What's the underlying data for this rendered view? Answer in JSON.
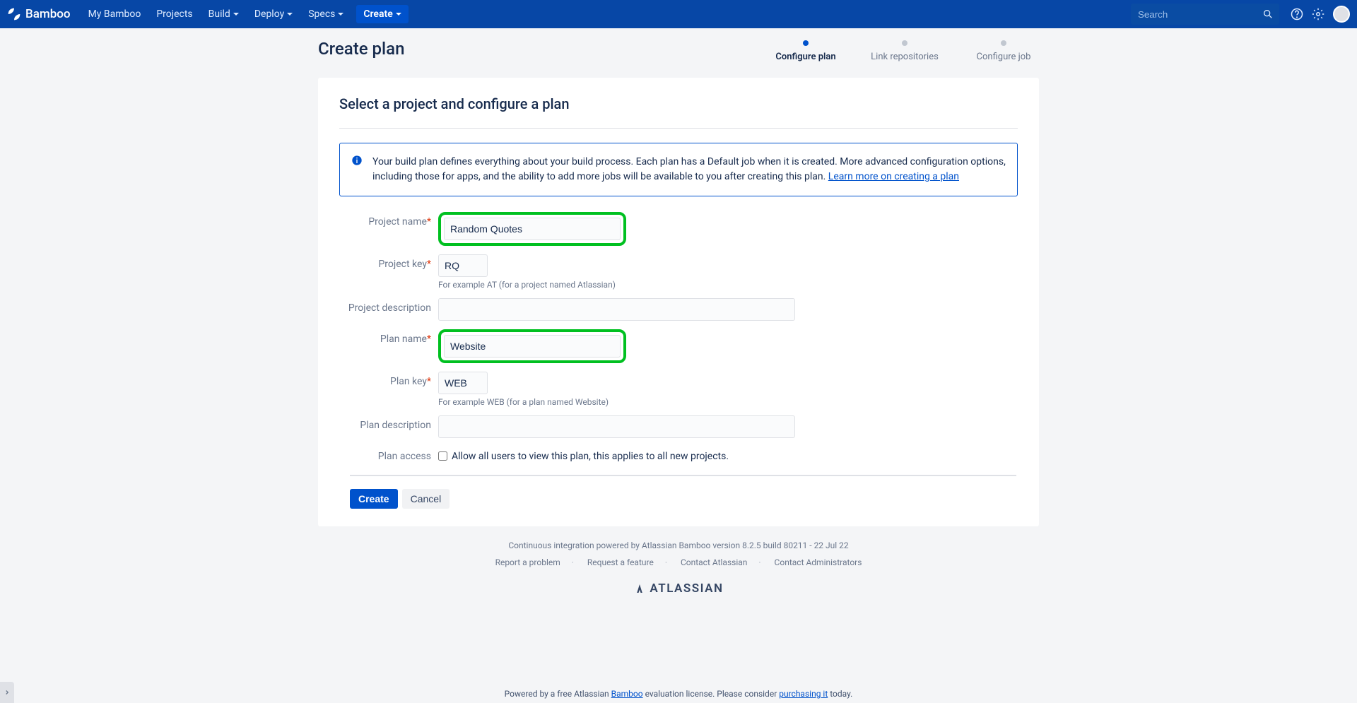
{
  "nav": {
    "appName": "Bamboo",
    "links": [
      "My Bamboo",
      "Projects",
      "Build",
      "Deploy",
      "Specs"
    ],
    "create": "Create",
    "searchPlaceholder": "Search"
  },
  "page": {
    "title": "Create plan",
    "steps": [
      {
        "label": "Configure plan",
        "active": true
      },
      {
        "label": "Link repositories",
        "active": false
      },
      {
        "label": "Configure job",
        "active": false
      }
    ]
  },
  "section": {
    "title": "Select a project and configure a plan",
    "info": {
      "text": "Your build plan defines everything about your build process. Each plan has a Default job when it is created. More advanced configuration options, including those for apps, and the ability to add more jobs will be available to you after creating this plan. ",
      "link": "Learn more on creating a plan"
    }
  },
  "form": {
    "projectName": {
      "label": "Project name",
      "value": "Random Quotes"
    },
    "projectKey": {
      "label": "Project key",
      "value": "RQ",
      "hint": "For example AT (for a project named Atlassian)"
    },
    "projectDesc": {
      "label": "Project description",
      "value": ""
    },
    "planName": {
      "label": "Plan name",
      "value": "Website"
    },
    "planKey": {
      "label": "Plan key",
      "value": "WEB",
      "hint": "For example WEB (for a plan named Website)"
    },
    "planDesc": {
      "label": "Plan description",
      "value": ""
    },
    "planAccess": {
      "label": "Plan access",
      "checkbox": "Allow all users to view this plan, this applies to all new projects."
    }
  },
  "buttons": {
    "create": "Create",
    "cancel": "Cancel"
  },
  "footer": {
    "text": "Continuous integration powered by Atlassian Bamboo version 8.2.5 build 80211 - 22 Jul 22",
    "links": [
      "Report a problem",
      "Request a feature",
      "Contact Atlassian",
      "Contact Administrators"
    ],
    "logo": "ATLASSIAN"
  },
  "banner": {
    "pre": "Powered by a free Atlassian ",
    "product": "Bamboo",
    "mid": " evaluation license. Please consider ",
    "link": "purchasing it",
    "post": " today."
  }
}
